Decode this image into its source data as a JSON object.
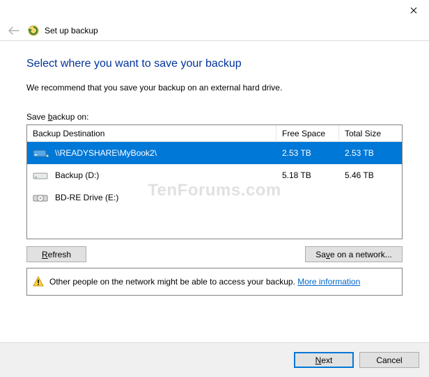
{
  "titlebar": {
    "close_label": "Close"
  },
  "header": {
    "window_title": "Set up backup"
  },
  "main": {
    "heading": "Select where you want to save your backup",
    "recommend": "We recommend that you save your backup on an external hard drive.",
    "save_label_pre": "Save ",
    "save_label_u": "b",
    "save_label_post": "ackup on:",
    "columns": {
      "dest": "Backup Destination",
      "free": "Free Space",
      "total": "Total Size"
    },
    "rows": [
      {
        "name": "\\\\READYSHARE\\MyBook2\\",
        "free": "2.53 TB",
        "total": "2.53 TB",
        "icon": "network",
        "selected": true
      },
      {
        "name": "Backup (D:)",
        "free": "5.18 TB",
        "total": "5.46 TB",
        "icon": "hdd",
        "selected": false
      },
      {
        "name": "BD-RE Drive (E:)",
        "free": "",
        "total": "",
        "icon": "optical",
        "selected": false
      }
    ],
    "refresh_u": "R",
    "refresh_post": "efresh",
    "save_net_pre": "Sa",
    "save_net_u": "v",
    "save_net_post": "e on a network...",
    "info_text": "Other people on the network might be able to access your backup. ",
    "info_link": "More information"
  },
  "footer": {
    "next_u": "N",
    "next_post": "ext",
    "cancel": "Cancel"
  },
  "watermark": "TenForums.com"
}
